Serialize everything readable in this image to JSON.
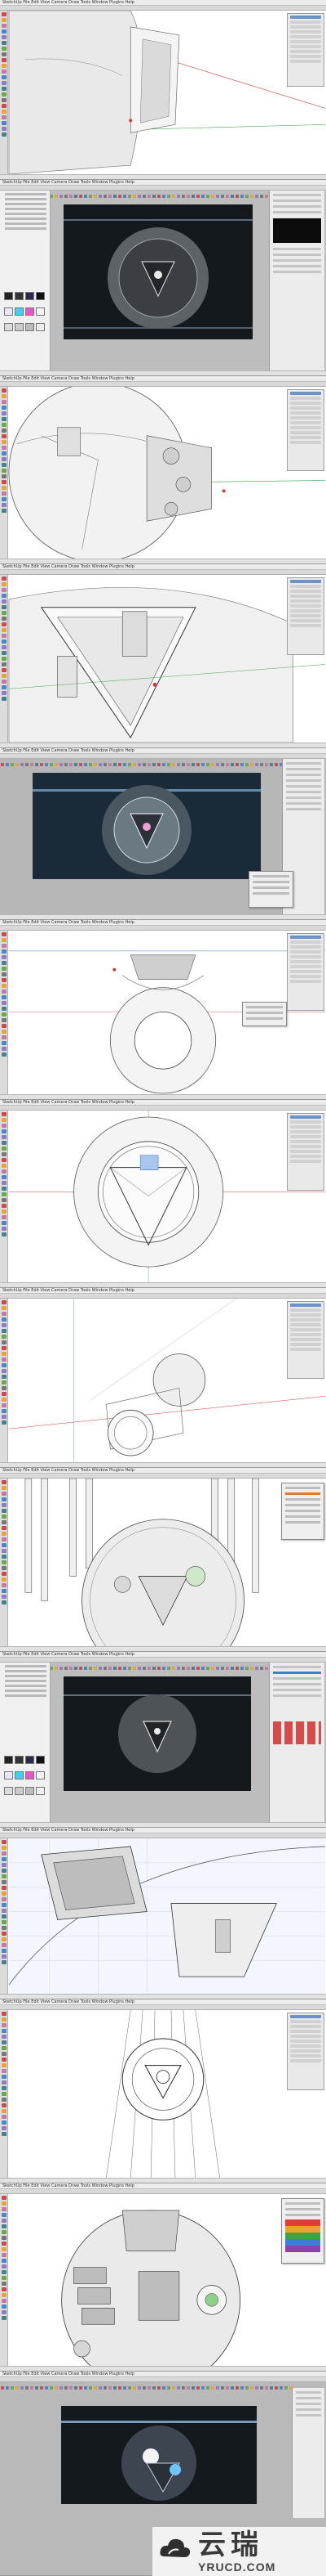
{
  "app": {
    "menu_label": "SketchUp  File  Edit  View  Camera  Draw  Tools  Window  Plugins  Help"
  },
  "shots": [
    {
      "kind": "modeling",
      "subject": "sphere-side-view"
    },
    {
      "kind": "render-setup",
      "subject": "front-render-preview"
    },
    {
      "kind": "modeling",
      "subject": "sphere-rear-detail"
    },
    {
      "kind": "modeling",
      "subject": "triangle-hatch-closeup"
    },
    {
      "kind": "render-preview",
      "subject": "front-render-blue"
    },
    {
      "kind": "modeling",
      "subject": "sphere-front-ortho"
    },
    {
      "kind": "modeling",
      "subject": "sphere-front-triangle"
    },
    {
      "kind": "modeling",
      "subject": "sphere-and-cylinder"
    },
    {
      "kind": "modeling",
      "subject": "sphere-with-cables"
    },
    {
      "kind": "render-setup",
      "subject": "front-render-dark"
    },
    {
      "kind": "modeling",
      "subject": "panel-closeup"
    },
    {
      "kind": "modeling",
      "subject": "front-wireframe"
    },
    {
      "kind": "modeling",
      "subject": "sphere-detailed-open"
    },
    {
      "kind": "render-preview",
      "subject": "final-render"
    }
  ],
  "colors": {
    "accent_blue": "#3d7fd6",
    "axis_red": "#d23b3b",
    "axis_green": "#3aa54a",
    "viewport_bg": "#ffffff",
    "render_bg": "#14191e"
  },
  "watermark": {
    "cn_text": "云瑞",
    "en_text": "YRUCD.COM",
    "icon": "cloud-logo-icon"
  }
}
